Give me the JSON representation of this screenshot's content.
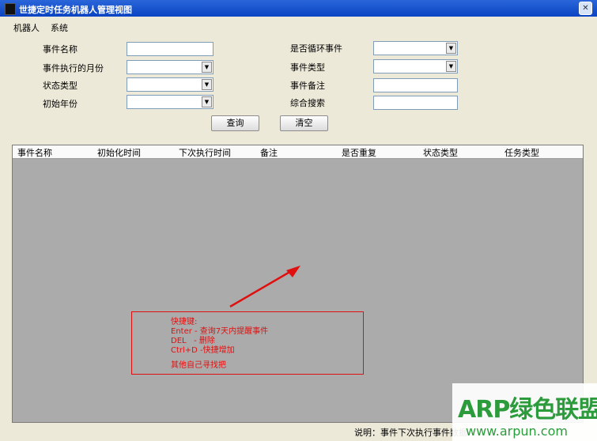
{
  "window": {
    "title": "世捷定时任务机器人管理视图",
    "close_glyph": "✕"
  },
  "menu": [
    "机器人",
    "系统"
  ],
  "form": {
    "event_name": "事件名称",
    "exec_month": "事件执行的月份",
    "status_type": "状态类型",
    "initial_year": "初始年份",
    "is_recurring": "是否循环事件",
    "event_type": "事件类型",
    "event_note": "事件备注",
    "search": "综合搜索"
  },
  "buttons": {
    "query": "查询",
    "clear": "清空"
  },
  "table": {
    "columns": [
      "事件名称",
      "初始化时间",
      "下次执行时间",
      "备注",
      "是否重复",
      "状态类型",
      "任务类型"
    ]
  },
  "annotation": {
    "lines": [
      "快捷键:",
      "Enter - 查询7天内提醒事件",
      "DEL   - 删除",
      "Ctrl+D -快捷增加",
      "其他自己寻找把"
    ],
    "color": "#e01010"
  },
  "status": {
    "text": "说明：事件下次执行事件数据"
  },
  "watermark": {
    "title": "ARP绿色联盟",
    "url": "www.arpun.com",
    "color": "#2c9b3c"
  }
}
